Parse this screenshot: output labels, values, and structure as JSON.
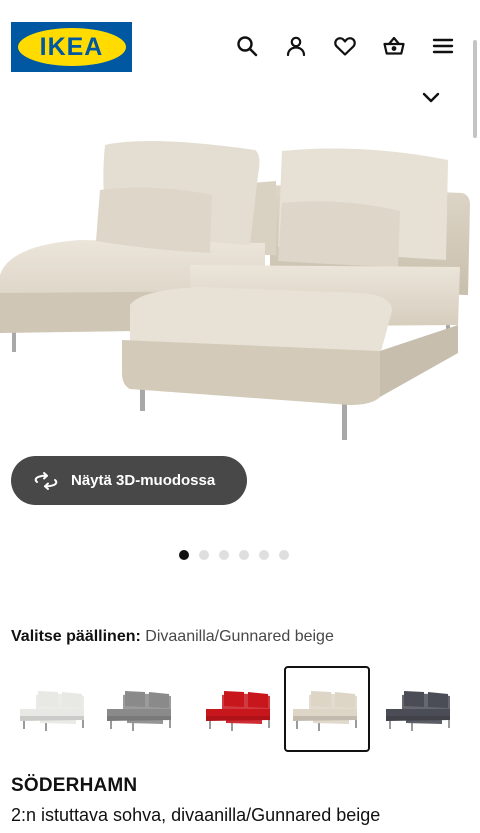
{
  "header": {
    "logo_text": "IKEA",
    "icons": [
      "search-icon",
      "user-icon",
      "heart-icon",
      "basket-icon",
      "menu-icon"
    ]
  },
  "gallery": {
    "button_3d_label": "Näytä 3D-muodossa",
    "dots_count": 6,
    "active_dot": 1
  },
  "cover": {
    "label": "Valitse päällinen:",
    "value": "Divaanilla/Gunnared beige",
    "swatches": [
      {
        "name": "white",
        "color": "#e8e8e4",
        "selected": false
      },
      {
        "name": "grey",
        "color": "#8a8a8a",
        "selected": false
      },
      {
        "name": "red",
        "color": "#c8161d",
        "selected": false
      },
      {
        "name": "beige",
        "color": "#ddd5c6",
        "selected": true
      },
      {
        "name": "dark-grey",
        "color": "#4a4d55",
        "selected": false
      }
    ]
  },
  "product": {
    "name": "SÖDERHAMN",
    "description": "2:n istuttava sohva, divaanilla/Gunnared beige"
  },
  "colors": {
    "brand_blue": "#0058a3",
    "brand_yellow": "#ffdb00",
    "button_dark": "#484848"
  }
}
